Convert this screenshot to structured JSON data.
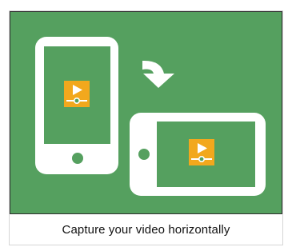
{
  "caption": {
    "text": "Capture your video horizontally"
  },
  "illustration": {
    "background_color": "#55a05f",
    "device_color": "#ffffff",
    "video_icon_color": "#f2a81d",
    "icons": [
      "portrait-phone-icon",
      "rotate-arrow-icon",
      "landscape-phone-icon",
      "video-play-icon"
    ]
  }
}
